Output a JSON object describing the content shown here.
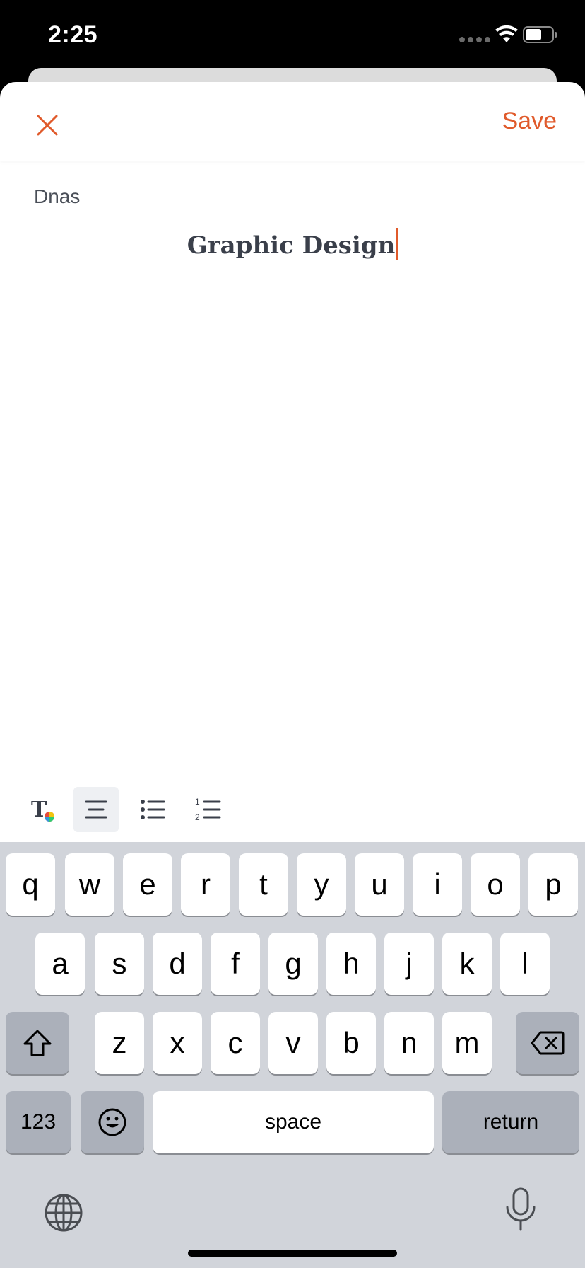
{
  "status_bar": {
    "time": "2:25"
  },
  "header": {
    "save_label": "Save"
  },
  "editor": {
    "author": "Dnas",
    "title": "Graphic Design"
  },
  "toolbar": {
    "tools": [
      "text-color-icon",
      "align-center-icon",
      "bullet-list-icon",
      "numbered-list-icon"
    ],
    "active_tool": "align-center-icon"
  },
  "keyboard": {
    "row1": [
      "q",
      "w",
      "e",
      "r",
      "t",
      "y",
      "u",
      "i",
      "o",
      "p"
    ],
    "row2": [
      "a",
      "s",
      "d",
      "f",
      "g",
      "h",
      "j",
      "k",
      "l"
    ],
    "row3": [
      "z",
      "x",
      "c",
      "v",
      "b",
      "n",
      "m"
    ],
    "numbers_label": "123",
    "space_label": "space",
    "return_label": "return"
  },
  "colors": {
    "accent": "#e05a2b",
    "text": "#3a3f4a",
    "keyboard_bg": "#d1d4da"
  }
}
